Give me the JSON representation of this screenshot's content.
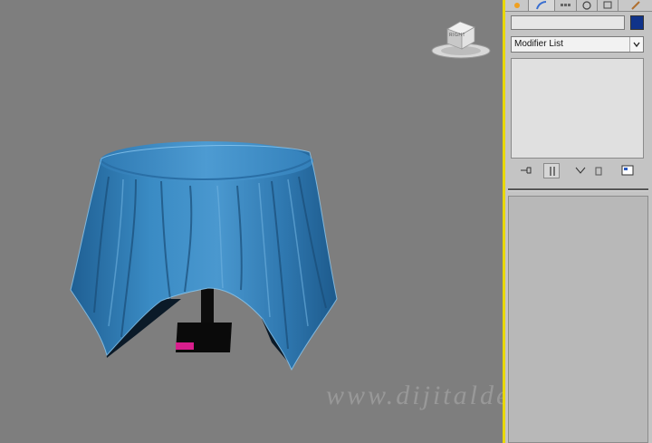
{
  "viewport": {
    "viewcube_label": "RIGHT",
    "watermark": "www.dijitaldevs.com",
    "object": "draped-table",
    "cloth_color": "#2e7bb3"
  },
  "command_panel": {
    "tabs": [
      {
        "name": "create-tab",
        "icon": "sun-star-icon"
      },
      {
        "name": "modify-tab",
        "icon": "bend-arc-icon"
      },
      {
        "name": "hierarchy-tab",
        "icon": "hierarchy-icon"
      },
      {
        "name": "motion-tab",
        "icon": "motion-circle-icon"
      },
      {
        "name": "display-tab",
        "icon": "display-monitor-icon"
      },
      {
        "name": "utilities-tab",
        "icon": "hammer-icon"
      }
    ],
    "object_name": "",
    "object_color": "#10338a",
    "modifier_list_label": "Modifier List",
    "accent_color": "#e8d800"
  },
  "stack_tools": [
    {
      "name": "pin-stack-button",
      "icon": "pin-icon"
    },
    {
      "name": "show-end-result-button",
      "icon": "end-result-icon"
    },
    {
      "name": "make-unique-button",
      "icon": "make-unique-icon"
    },
    {
      "name": "remove-modifier-button",
      "icon": "trash-icon"
    },
    {
      "name": "configure-modifier-sets-button",
      "icon": "configure-icon"
    }
  ]
}
